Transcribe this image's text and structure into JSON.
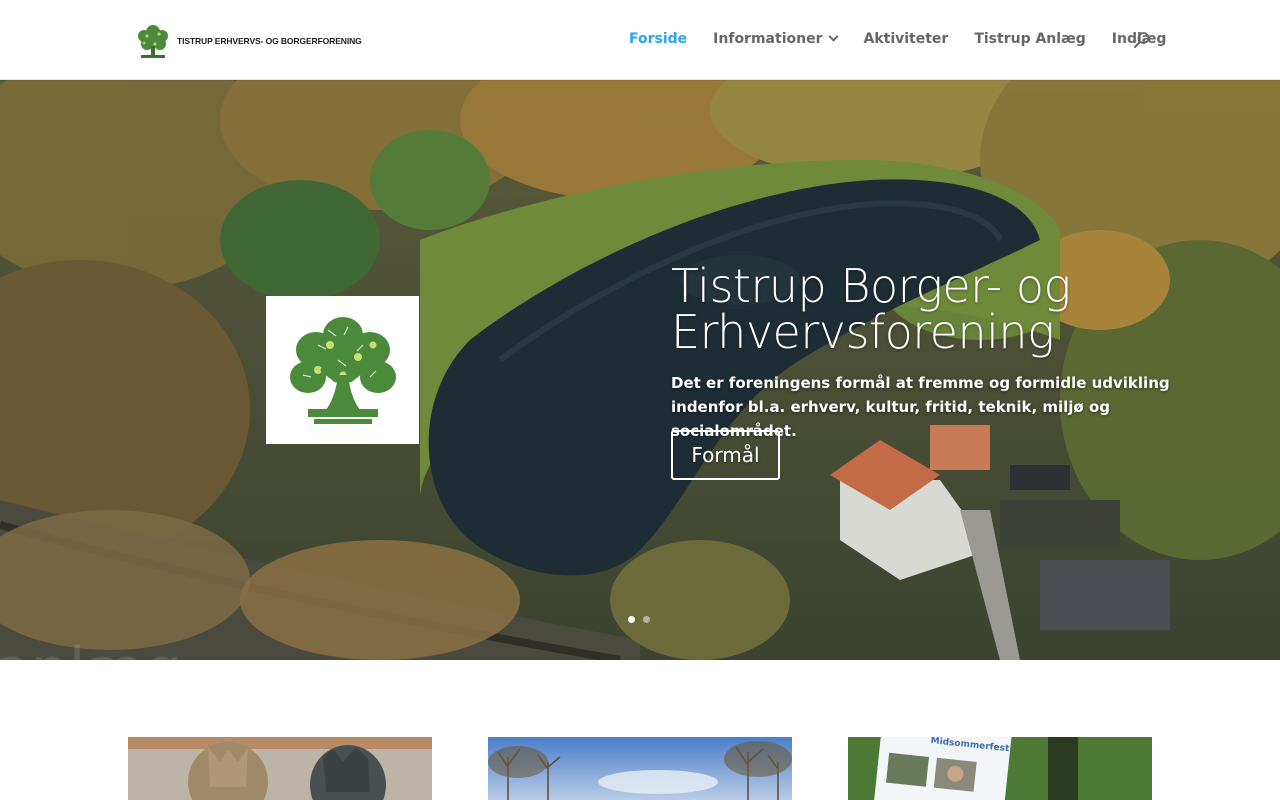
{
  "header": {
    "logo_text": "TISTRUP ERHVERVS- OG BORGERFORENING",
    "nav": [
      {
        "label": "Forside",
        "active": true,
        "dropdown": false
      },
      {
        "label": "Informationer",
        "active": false,
        "dropdown": true
      },
      {
        "label": "Aktiviteter",
        "active": false,
        "dropdown": false
      },
      {
        "label": "Tistrup Anlæg",
        "active": false,
        "dropdown": false
      },
      {
        "label": "Indlæg",
        "active": false,
        "dropdown": false
      }
    ],
    "search_icon": "search-icon"
  },
  "hero": {
    "title_line1": "Tistrup Borger- og",
    "title_line2": "Erhvervsforening",
    "description": "Det er foreningens formål at fremme og formidle udvikling indenfor bl.a. erhverv, kultur, fritid, teknik, miljø og socialområdet.",
    "button_label": "Formål",
    "watermark": "anlæg",
    "slide_count": 2,
    "active_slide": 1
  },
  "colors": {
    "accent": "#2ea3f2",
    "nav_text": "#666666",
    "logo_green": "#4c8a3b"
  }
}
